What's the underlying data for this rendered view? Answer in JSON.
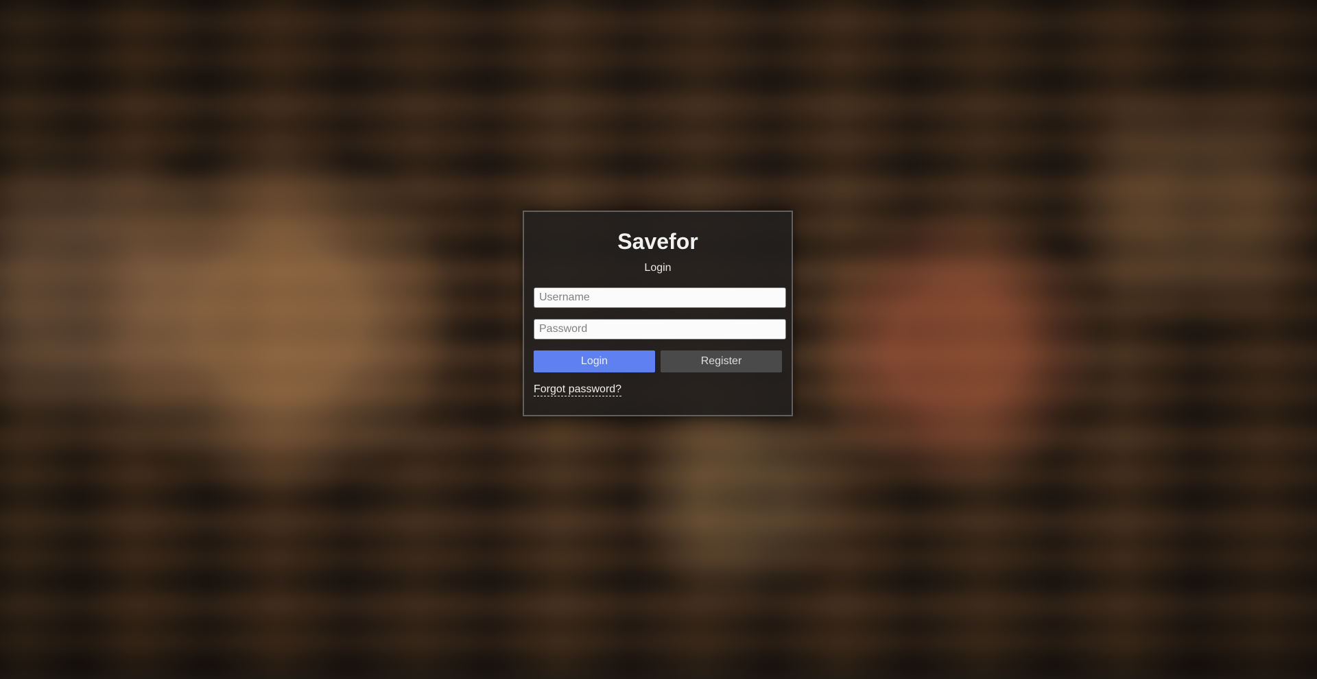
{
  "app": {
    "title": "Savefor",
    "subtitle": "Login"
  },
  "form": {
    "username_placeholder": "Username",
    "password_placeholder": "Password",
    "login_label": "Login",
    "register_label": "Register",
    "forgot_label": "Forgot password?"
  },
  "colors": {
    "primary": "#5f80f0",
    "secondary": "#4a4a4a",
    "card_background": "#221f1e"
  }
}
